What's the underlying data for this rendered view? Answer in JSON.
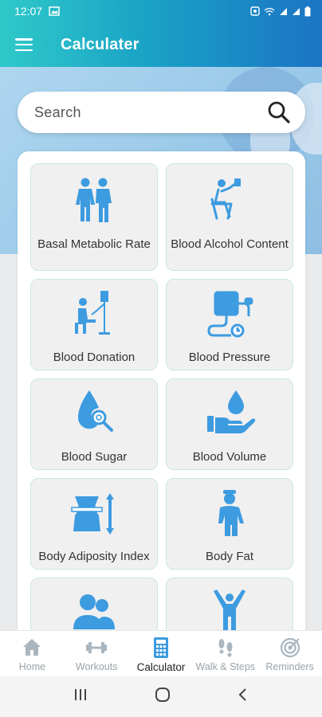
{
  "status_bar": {
    "time": "12:07",
    "icons": [
      "image-icon",
      "alarm-icon",
      "wifi-icon",
      "signal-icon",
      "signal-icon",
      "battery-icon"
    ]
  },
  "app_bar": {
    "title": "Calculater"
  },
  "search": {
    "placeholder": "Search"
  },
  "calculators": [
    {
      "label": "Basal Metabolic Rate",
      "icon": "people-icon"
    },
    {
      "label": "Blood Alcohol Content",
      "icon": "drinking-icon"
    },
    {
      "label": "Blood Donation",
      "icon": "blood-donation-icon"
    },
    {
      "label": "Blood Pressure",
      "icon": "blood-pressure-icon"
    },
    {
      "label": "Blood Sugar",
      "icon": "blood-drop-search-icon"
    },
    {
      "label": "Blood Volume",
      "icon": "hand-drop-icon"
    },
    {
      "label": "Body Adiposity Index",
      "icon": "waist-measure-icon"
    },
    {
      "label": "Body Fat",
      "icon": "person-icon"
    },
    {
      "label": "",
      "icon": "users-icon"
    },
    {
      "label": "",
      "icon": "arms-up-icon"
    }
  ],
  "bottom_nav": {
    "items": [
      {
        "label": "Home",
        "icon": "home-icon",
        "active": false
      },
      {
        "label": "Workouts",
        "icon": "dumbbell-icon",
        "active": false
      },
      {
        "label": "Calculator",
        "icon": "calculator-icon",
        "active": true
      },
      {
        "label": "Walk & Steps",
        "icon": "footprints-icon",
        "active": false
      },
      {
        "label": "Reminders",
        "icon": "target-icon",
        "active": false
      }
    ]
  },
  "colors": {
    "accent": "#3d9be0",
    "header_start": "#2fc9c9",
    "header_end": "#1b74c4",
    "card_border": "#c8e6e8"
  }
}
